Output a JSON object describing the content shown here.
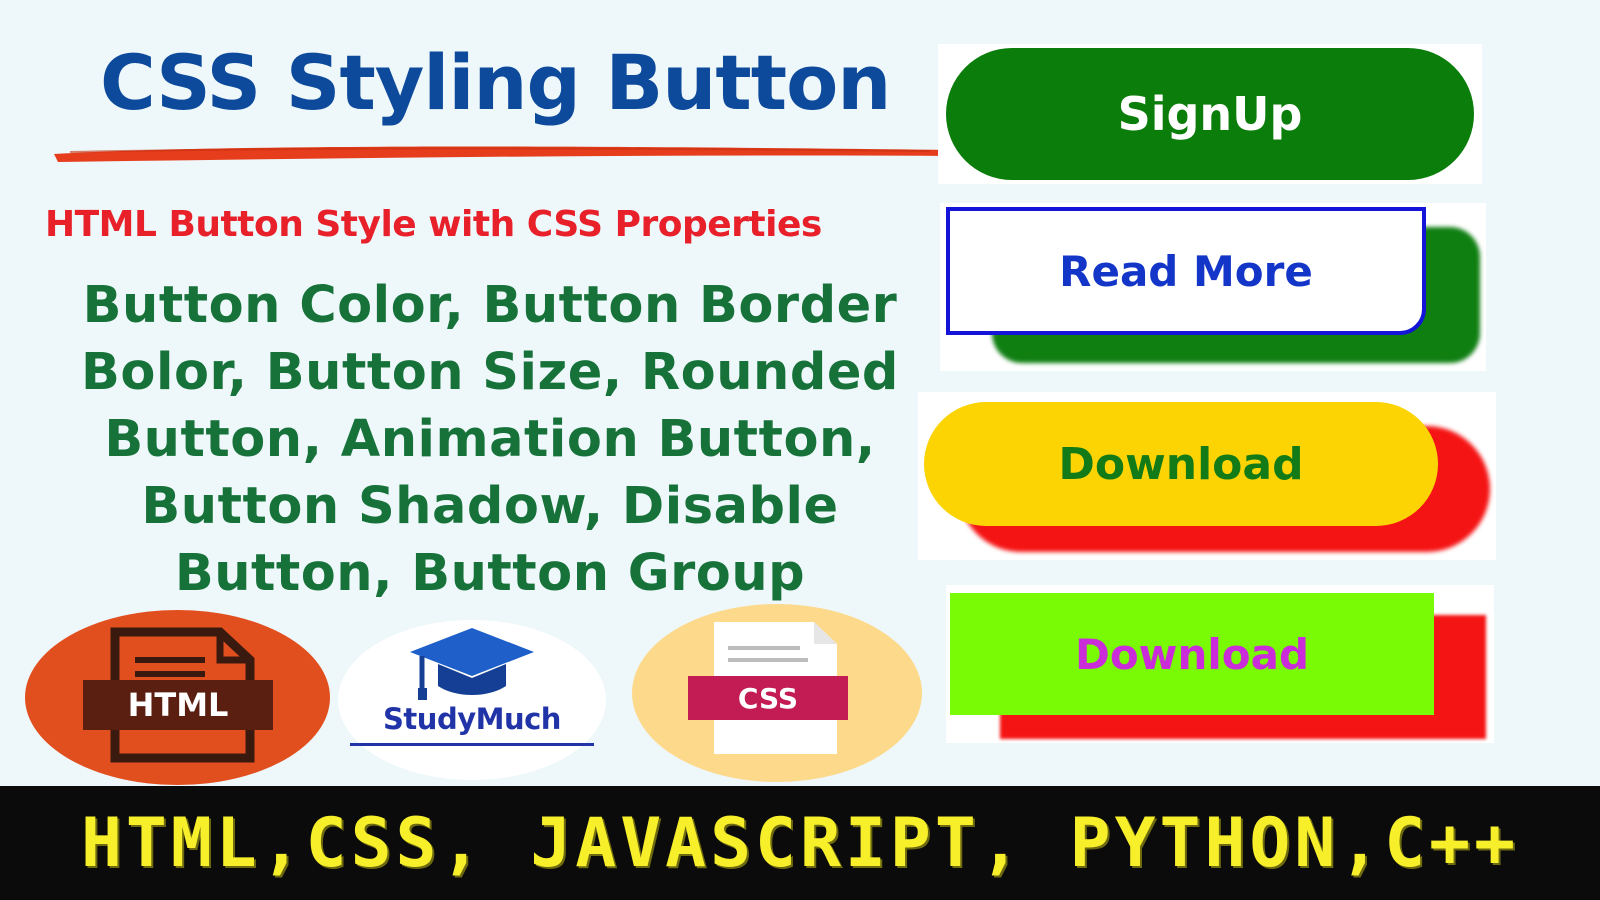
{
  "header": {
    "title": "CSS Styling Button",
    "subtitle": "HTML Button Style with CSS Properties",
    "properties_text": "Button Color, Button Border Bolor, Button Size, Rounded Button, Animation Button, Button Shadow, Disable Button, Button Group"
  },
  "logos": {
    "html_label": "HTML",
    "studymuch_label": "StudyMuch",
    "css_label": "CSS"
  },
  "buttons": {
    "signup": "SignUp",
    "read_more": "Read More",
    "download_yellow": "Download",
    "download_green": "Download"
  },
  "banner": {
    "text": "HTML,CSS, JAVASCRIPT, PYTHON,C++"
  },
  "colors": {
    "title": "#0d4a9c",
    "subtitle": "#e8202a",
    "properties": "#17723a",
    "signup_bg": "#0a7d0a",
    "readmore_border": "#1414d8",
    "download_yellow_bg": "#fcd404",
    "download_green_bg": "#79fb05",
    "shadow_red": "#f51414",
    "banner_text": "#f7ef2a"
  },
  "icons": [
    "html-file-icon",
    "graduation-cap-icon",
    "css-file-icon"
  ]
}
